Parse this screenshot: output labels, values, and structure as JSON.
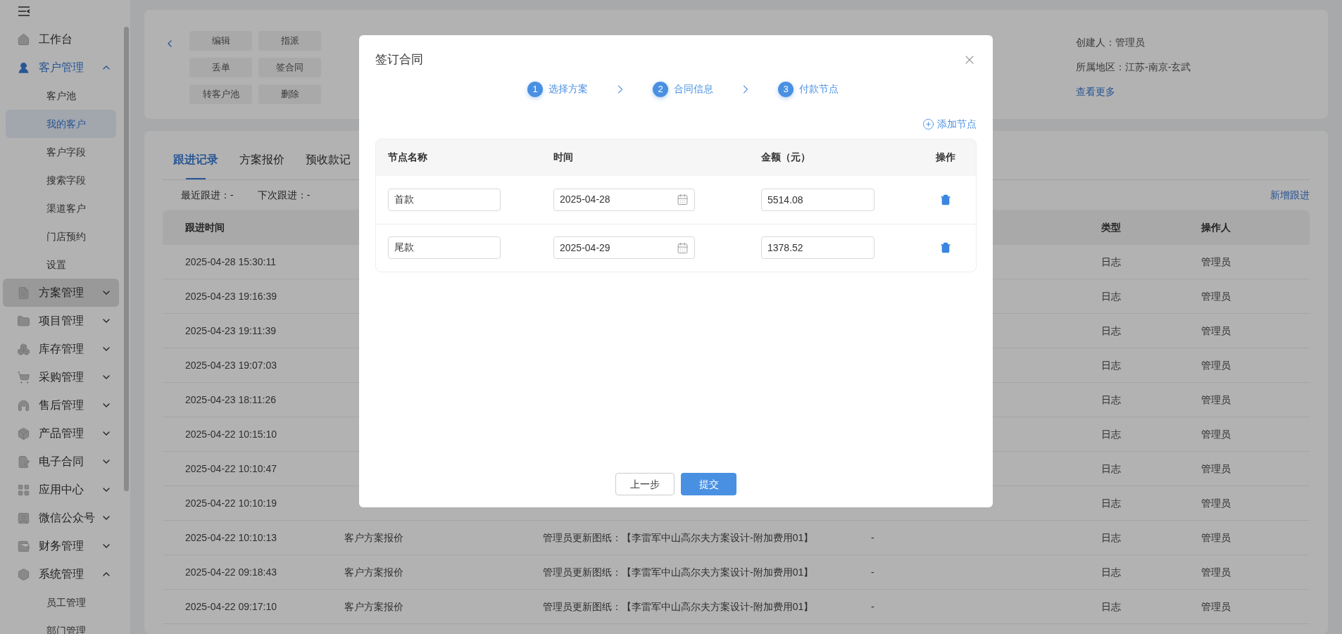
{
  "sidebar": {
    "items": [
      {
        "label": "工作台",
        "active": false,
        "hovered": false,
        "has_arrow": false
      },
      {
        "label": "客户管理",
        "expanded": true,
        "active": true,
        "hovered": false,
        "has_arrow": true,
        "children": [
          {
            "label": "客户池",
            "selected": false
          },
          {
            "label": "我的客户",
            "selected": true
          },
          {
            "label": "客户字段",
            "selected": false
          },
          {
            "label": "搜索字段",
            "selected": false
          },
          {
            "label": "渠道客户",
            "selected": false
          },
          {
            "label": "门店预约",
            "selected": false
          },
          {
            "label": "设置",
            "selected": false
          }
        ]
      },
      {
        "label": "方案管理",
        "expanded": false,
        "active": false,
        "hovered": true,
        "has_arrow": true
      },
      {
        "label": "项目管理",
        "expanded": false,
        "active": false,
        "hovered": false,
        "has_arrow": true
      },
      {
        "label": "库存管理",
        "expanded": false,
        "active": false,
        "hovered": false,
        "has_arrow": true
      },
      {
        "label": "采购管理",
        "expanded": false,
        "active": false,
        "hovered": false,
        "has_arrow": true
      },
      {
        "label": "售后管理",
        "expanded": false,
        "active": false,
        "hovered": false,
        "has_arrow": true
      },
      {
        "label": "产品管理",
        "expanded": false,
        "active": false,
        "hovered": false,
        "has_arrow": true
      },
      {
        "label": "电子合同",
        "expanded": false,
        "active": false,
        "hovered": false,
        "has_arrow": true
      },
      {
        "label": "应用中心",
        "expanded": false,
        "active": false,
        "hovered": false,
        "has_arrow": true
      },
      {
        "label": "微信公众号",
        "expanded": false,
        "active": false,
        "hovered": false,
        "has_arrow": true
      },
      {
        "label": "财务管理",
        "expanded": false,
        "active": false,
        "hovered": false,
        "has_arrow": true
      },
      {
        "label": "系统管理",
        "expanded": true,
        "active": false,
        "hovered": false,
        "has_arrow": true,
        "children": [
          {
            "label": "员工管理",
            "selected": false
          },
          {
            "label": "部门管理",
            "selected": false
          }
        ]
      }
    ]
  },
  "customer_card": {
    "actions": [
      "编辑",
      "指派",
      "丢单",
      "签合同",
      "转客户池",
      "删除"
    ],
    "creator": "创建人：管理员",
    "region": "所属地区：江苏-南京-玄武",
    "more_link": "查看更多"
  },
  "tabs": [
    {
      "label": "跟进记录",
      "selected": true
    },
    {
      "label": "方案报价",
      "selected": false
    },
    {
      "label": "预收款记",
      "selected": false
    }
  ],
  "follow_info": {
    "last": "最近跟进：-",
    "next": "下次跟进：-",
    "add_link": "新增跟进"
  },
  "table": {
    "columns": {
      "time": "跟进时间",
      "type": "类型",
      "operator": "操作人"
    },
    "rows": [
      {
        "time": "2025-04-28 15:30:11",
        "type": "日志",
        "operator": "管理员"
      },
      {
        "time": "2025-04-23 19:16:39",
        "type": "日志",
        "operator": "管理员"
      },
      {
        "time": "2025-04-23 19:11:39",
        "type": "日志",
        "operator": "管理员"
      },
      {
        "time": "2025-04-23 19:07:03",
        "type": "日志",
        "operator": "管理员"
      },
      {
        "time": "2025-04-23 18:11:26",
        "type": "日志",
        "operator": "管理员"
      },
      {
        "time": "2025-04-22 10:15:10",
        "type": "日志",
        "operator": "管理员"
      },
      {
        "time": "2025-04-22 10:10:47",
        "type": "日志",
        "operator": "管理员"
      },
      {
        "time": "2025-04-22 10:10:19",
        "type": "日志",
        "operator": "管理员"
      },
      {
        "time": "2025-04-22 10:10:13",
        "source": "客户方案报价",
        "content": "管理员更新图纸：【李雷军中山高尔夫方案设计-附加费用01】",
        "column_4": "-",
        "type": "日志",
        "operator": "管理员"
      },
      {
        "time": "2025-04-22 09:18:43",
        "source": "客户方案报价",
        "content": "管理员更新图纸：【李雷军中山高尔夫方案设计-附加费用01】",
        "column_4": "-",
        "type": "日志",
        "operator": "管理员"
      },
      {
        "time": "2025-04-22 09:17:10",
        "source": "客户方案报价",
        "content": "管理员更新图纸：【李雷军中山高尔夫方案设计-附加费用01】",
        "column_4": "-",
        "type": "日志",
        "operator": "管理员"
      }
    ]
  },
  "dialog": {
    "title": "签订合同",
    "steps": [
      {
        "number": "1",
        "label": "选择方案"
      },
      {
        "number": "2",
        "label": "合同信息"
      },
      {
        "number": "3",
        "label": "付款节点"
      }
    ],
    "add_node": "添加节点",
    "columns": [
      "节点名称",
      "时间",
      "金额（元）",
      "操作"
    ],
    "nodes": [
      {
        "name": "首款",
        "date": "2025-04-28",
        "amount": "5514.08"
      },
      {
        "name": "尾款",
        "date": "2025-04-29",
        "amount": "1378.52"
      }
    ],
    "buttons": {
      "prev": "上一步",
      "submit": "提交"
    }
  }
}
